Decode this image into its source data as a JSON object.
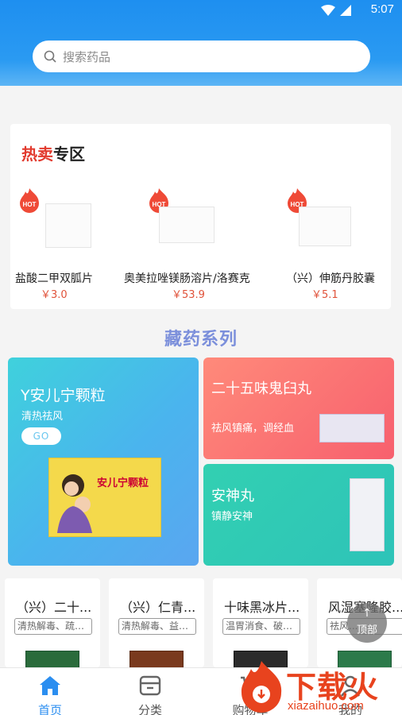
{
  "status": {
    "time": "5:07"
  },
  "search": {
    "placeholder": "搜索药品"
  },
  "hot": {
    "title_red": "热卖",
    "title_dark": "专区",
    "items": [
      {
        "name": "盐酸二甲双胍片",
        "price": "￥3.0",
        "badge": "HOT"
      },
      {
        "name": "奥美拉唑镁肠溶片/洛赛克",
        "price": "￥53.9",
        "badge": "HOT"
      },
      {
        "name": "（兴）伸筋丹胶囊",
        "price": "￥5.1",
        "badge": "HOT"
      }
    ]
  },
  "series": {
    "title": "藏药系列"
  },
  "features": {
    "big": {
      "title": "Y安儿宁颗粒",
      "subtitle": "清热祛风",
      "go": "GO",
      "box_label": "安儿宁颗粒"
    },
    "red": {
      "title": "二十五味鬼臼丸",
      "subtitle": "祛风镇痛，调经血"
    },
    "teal": {
      "title": "安神丸",
      "subtitle": "镇静安神"
    }
  },
  "products": [
    {
      "name": "（兴）二十...",
      "tag": "清热解毒、疏肝..."
    },
    {
      "name": "（兴）仁青...",
      "tag": "清热解毒、益肝..."
    },
    {
      "name": "十味黑冰片...",
      "tag": "温胃消食、破积..."
    },
    {
      "name": "风湿塞隆胶...",
      "tag": "祛风..."
    }
  ],
  "back_to_top": {
    "label": "顶部"
  },
  "nav": {
    "items": [
      {
        "label": "首页",
        "icon": "home-icon",
        "active": true
      },
      {
        "label": "分类",
        "icon": "category-icon",
        "active": false
      },
      {
        "label": "购物车",
        "icon": "cart-icon",
        "active": false
      },
      {
        "label": "我的",
        "icon": "user-icon",
        "active": false
      }
    ]
  },
  "watermark": {
    "text": "下载火",
    "url": "xiazaihuo.com"
  },
  "colors": {
    "primary": "#2b8ef0",
    "hot_red": "#e23a2e",
    "price": "#e0523a",
    "series_title": "#7b8fdb"
  }
}
